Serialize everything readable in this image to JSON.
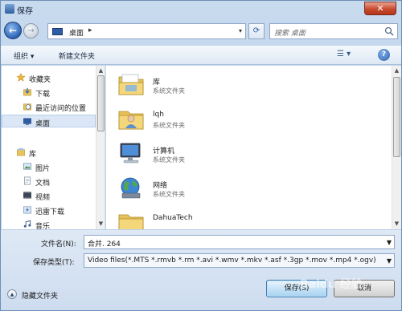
{
  "window": {
    "title": "保存",
    "close_glyph": "✕"
  },
  "address_bar": {
    "location": "桌面",
    "separator": "▸",
    "dropdown_glyph": "▾"
  },
  "search": {
    "placeholder": "搜索 桌面"
  },
  "toolbar": {
    "organize_label": "组织 ▾",
    "new_folder_label": "新建文件夹",
    "view_label": "☰ ▾",
    "help_label": "?"
  },
  "sidebar": {
    "items": [
      {
        "label": "收藏夹",
        "icon": "star-icon"
      },
      {
        "label": "下载",
        "icon": "download-folder-icon"
      },
      {
        "label": "最近访问的位置",
        "icon": "recent-places-icon"
      },
      {
        "label": "桌面",
        "icon": "desktop-icon",
        "selected": true
      },
      {
        "label": "库",
        "icon": "library-icon"
      },
      {
        "label": "图片",
        "icon": "pictures-icon"
      },
      {
        "label": "文档",
        "icon": "documents-icon"
      },
      {
        "label": "视频",
        "icon": "videos-icon"
      },
      {
        "label": "迅雷下载",
        "icon": "thunder-download-icon"
      },
      {
        "label": "音乐",
        "icon": "music-icon"
      }
    ]
  },
  "files": [
    {
      "name": "库",
      "type": "系统文件夹",
      "icon": "library-folder-icon"
    },
    {
      "name": "lqh",
      "type": "系统文件夹",
      "icon": "user-folder-icon"
    },
    {
      "name": "计算机",
      "type": "系统文件夹",
      "icon": "computer-icon"
    },
    {
      "name": "网络",
      "type": "系统文件夹",
      "icon": "network-icon"
    },
    {
      "name": "DahuaTech",
      "type": "",
      "icon": "folder-icon"
    }
  ],
  "form": {
    "filename_label": "文件名(N):",
    "filename_value": "合并. 264",
    "filetype_label": "保存类型(T):",
    "filetype_value": "Video files(*.MTS *.rmvb *.rm *.avi *.wmv *.mkv *.asf *.3gp *.mov *.mp4 *.ogv)",
    "hide_folders_label": "隐藏文件夹",
    "save_label": "保存(S)",
    "cancel_label": "取消"
  },
  "watermark": "Baidu 经验",
  "colors": {
    "title_bar": "#c8daee",
    "close_button": "#c94b2f",
    "selection": "#dbe7f6",
    "save_button": "#c7e3f8"
  }
}
